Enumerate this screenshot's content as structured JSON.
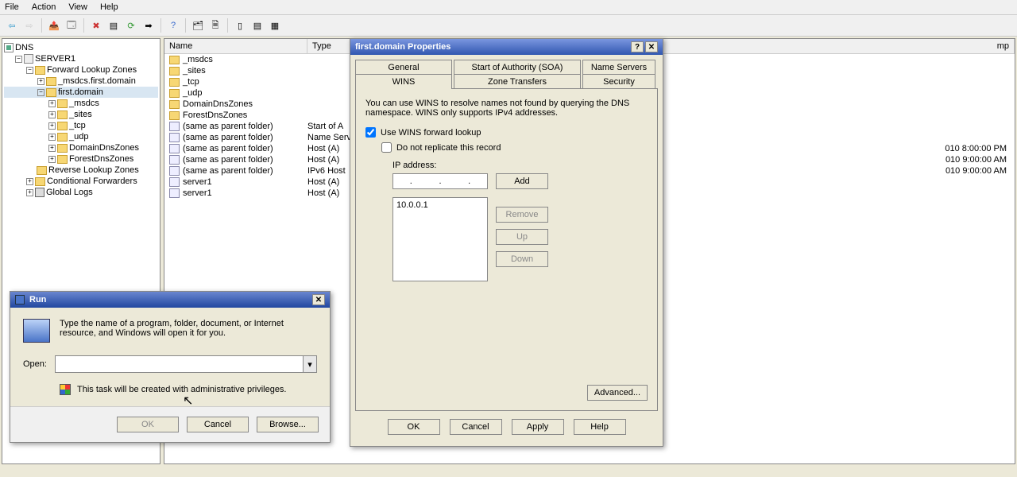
{
  "menu": {
    "file": "File",
    "action": "Action",
    "view": "View",
    "help": "Help"
  },
  "tree": {
    "root": "DNS",
    "server": "SERVER1",
    "fwd": "Forward Lookup Zones",
    "msdcs_zone": "_msdcs.first.domain",
    "first_domain": "first.domain",
    "msdcs": "_msdcs",
    "sites": "_sites",
    "tcp": "_tcp",
    "udp": "_udp",
    "ddz": "DomainDnsZones",
    "fdz": "ForestDnsZones",
    "rev": "Reverse Lookup Zones",
    "cond": "Conditional Forwarders",
    "logs": "Global Logs"
  },
  "list": {
    "headers": {
      "name": "Name",
      "type": "Type",
      "timestamp": "mp"
    },
    "rows": [
      {
        "name": "_msdcs",
        "type": "",
        "ts": ""
      },
      {
        "name": "_sites",
        "type": "",
        "ts": ""
      },
      {
        "name": "_tcp",
        "type": "",
        "ts": ""
      },
      {
        "name": "_udp",
        "type": "",
        "ts": ""
      },
      {
        "name": "DomainDnsZones",
        "type": "",
        "ts": ""
      },
      {
        "name": "ForestDnsZones",
        "type": "",
        "ts": ""
      },
      {
        "name": "(same as parent folder)",
        "type": "Start of A",
        "ts": ""
      },
      {
        "name": "(same as parent folder)",
        "type": "Name Serv",
        "ts": ""
      },
      {
        "name": "(same as parent folder)",
        "type": "Host (A)",
        "ts": "010 8:00:00 PM"
      },
      {
        "name": "(same as parent folder)",
        "type": "Host (A)",
        "ts": "010 9:00:00 AM"
      },
      {
        "name": "(same as parent folder)",
        "type": "IPv6 Host",
        "ts": "010 9:00:00 AM"
      },
      {
        "name": "server1",
        "type": "Host (A)",
        "ts": ""
      },
      {
        "name": "server1",
        "type": "Host (A)",
        "ts": ""
      }
    ]
  },
  "props": {
    "title": "first.domain Properties",
    "tabs": {
      "general": "General",
      "soa": "Start of Authority (SOA)",
      "ns": "Name Servers",
      "wins": "WINS",
      "zt": "Zone Transfers",
      "sec": "Security"
    },
    "desc": "You can use WINS to resolve names not found by querying the DNS namespace. WINS only supports IPv4 addresses.",
    "use_wins": "Use WINS forward lookup",
    "no_repl": "Do not replicate this record",
    "ip_label": "IP address:",
    "add": "Add",
    "remove": "Remove",
    "up": "Up",
    "down": "Down",
    "advanced": "Advanced...",
    "wins_servers": [
      "10.0.0.1"
    ],
    "ok": "OK",
    "cancel": "Cancel",
    "apply": "Apply",
    "help": "Help"
  },
  "run": {
    "title": "Run",
    "desc": "Type the name of a program, folder, document, or Internet resource, and Windows will open it for you.",
    "open_label": "Open:",
    "admin_note": "This task will be created with administrative privileges.",
    "ok": "OK",
    "cancel": "Cancel",
    "browse": "Browse..."
  }
}
